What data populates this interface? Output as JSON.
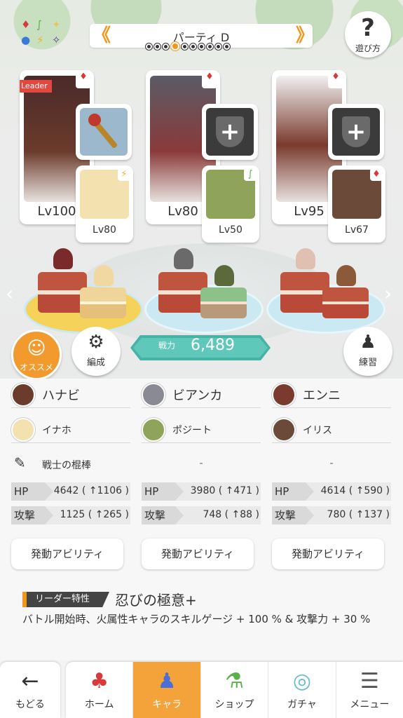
{
  "header": {
    "party_title": "パーティ D",
    "party_prev": "《",
    "party_next": "》",
    "page_count": 10,
    "active_page": 3,
    "howto_icon": "?",
    "howto_label": "遊び方",
    "element_icons": [
      "♦",
      "∫",
      "✦",
      "●",
      "⚡",
      "✧"
    ]
  },
  "slots": [
    {
      "leader_label": "Leader",
      "main_level": "Lv100",
      "main_element": "♦",
      "main_art_color": "#4a2a2a",
      "weapon_equipped": true,
      "sub_level": "Lv80",
      "sub_element": "⚡",
      "sub_element_color": "#e5b62a",
      "sub_art_color": "#f3e2b0"
    },
    {
      "leader_label": "",
      "main_level": "Lv80",
      "main_element": "♦",
      "main_art_color": "#5b5b66",
      "weapon_equipped": false,
      "sub_level": "Lv50",
      "sub_element": "∫",
      "sub_element_color": "#5bb04a",
      "sub_art_color": "#8fa35b"
    },
    {
      "leader_label": "",
      "main_level": "Lv95",
      "main_element": "♦",
      "main_art_color": "#7a3a2e",
      "weapon_equipped": false,
      "sub_level": "Lv67",
      "sub_element": "♦",
      "sub_element_color": "#d63a3a",
      "sub_art_color": "#6b4a3a"
    }
  ],
  "actions": {
    "osusume_icon": "☺",
    "osusume_label": "オススメ",
    "hensei_icon": "⚙",
    "hensei_label": "編成",
    "power_label": "戦力",
    "power_value": "6,489",
    "renshu_icon": "♟",
    "renshu_label": "練習"
  },
  "members": [
    {
      "main_name": "ハナビ",
      "sub_name": "イナホ",
      "weapon_name": "戦士の棍棒",
      "weapon_none": "",
      "hp_label": "HP",
      "hp_value": "4642 ( ↑1106 )",
      "atk_label": "攻撃",
      "atk_value": "1125 ( ↑265 )",
      "ability_label": "発動アビリティ"
    },
    {
      "main_name": "ビアンカ",
      "sub_name": "ポジート",
      "weapon_name": "",
      "weapon_none": "-",
      "hp_label": "HP",
      "hp_value": "3980 ( ↑471 )",
      "atk_label": "攻撃",
      "atk_value": "748 ( ↑88 )",
      "ability_label": "発動アビリティ"
    },
    {
      "main_name": "エンニ",
      "sub_name": "イリス",
      "weapon_name": "",
      "weapon_none": "-",
      "hp_label": "HP",
      "hp_value": "4614 ( ↑590 )",
      "atk_label": "攻撃",
      "atk_value": "780 ( ↑137 )",
      "ability_label": "発動アビリティ"
    }
  ],
  "leader": {
    "tag": "リーダー特性",
    "skill_name": "忍びの極意+",
    "description": "バトル開始時、火属性キャラのスキルゲージ + 100 % & 攻撃力 + 30 %"
  },
  "nav": {
    "back_icon": "←",
    "back_label": "もどる",
    "items": [
      {
        "icon": "♣",
        "label": "ホーム"
      },
      {
        "icon": "♟",
        "label": "キャラ"
      },
      {
        "icon": "⚗",
        "label": "ショップ"
      },
      {
        "icon": "◎",
        "label": "ガチャ"
      },
      {
        "icon": "☰",
        "label": "メニュー"
      }
    ]
  },
  "colors": {
    "accent": "#f1961d",
    "power": "#5fc8bb",
    "nav_active": "#f4a23a",
    "fire": "#d63a3a"
  }
}
